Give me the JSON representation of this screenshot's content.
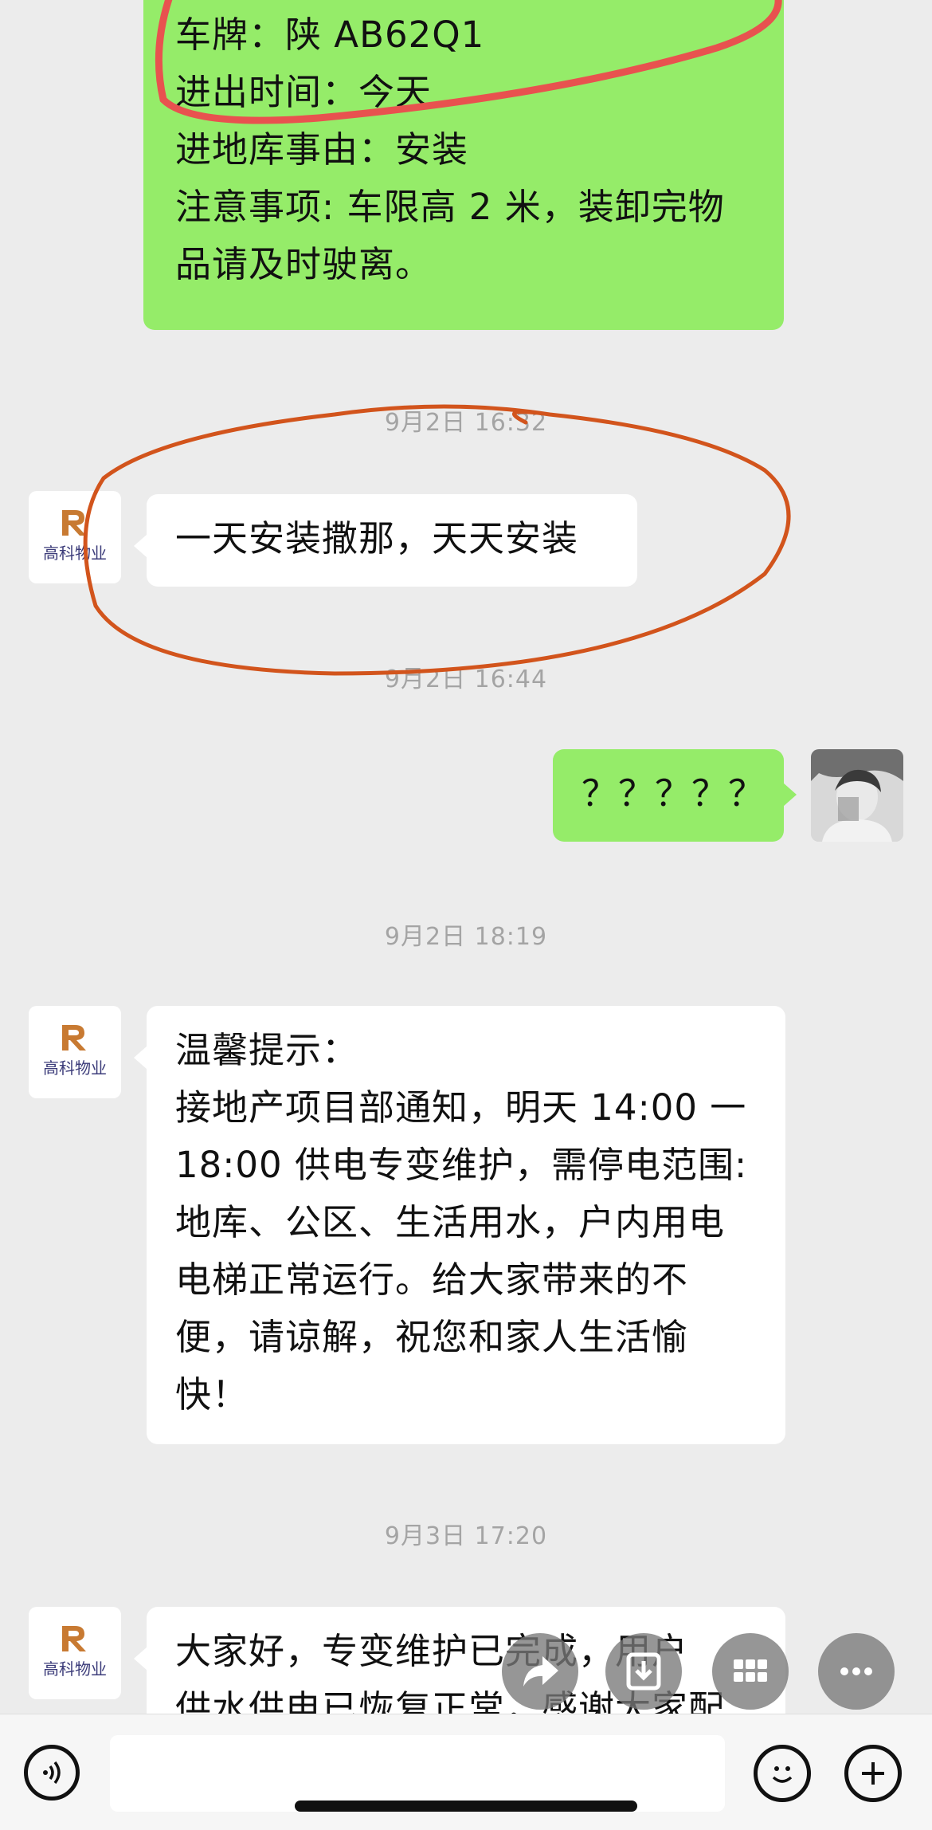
{
  "messages": [
    {
      "sender": "me",
      "lines": [
        "车牌：陕 AB62Q1",
        "进出时间：今天",
        "进地库事由：安装",
        "注意事项: 车限高 2 米，装卸完物",
        "品请及时驶离。"
      ]
    },
    {
      "time": "9月2日 16:32"
    },
    {
      "sender": "property",
      "avatar_text": "高科物业",
      "lines": [
        "一天安装撒那，天天安装"
      ]
    },
    {
      "time": "9月2日 16:44"
    },
    {
      "sender": "me",
      "lines": [
        "？？？？？"
      ]
    },
    {
      "time": "9月2日 18:19"
    },
    {
      "sender": "property",
      "avatar_text": "高科物业",
      "lines": [
        "温馨提示：",
        "接地产项目部通知，明天 14:00 一",
        "18:00 供电专变维护，需停电范围:",
        "地库、公区、生活用水，户内用电",
        "电梯正常运行。给大家带来的不",
        "便，请谅解，祝您和家人生活愉",
        "快！"
      ]
    },
    {
      "time": "9月3日 17:20"
    },
    {
      "sender": "property",
      "avatar_text": "高科物业",
      "lines": [
        "大家好，专变维护已完成，用户",
        "供水供电已恢复正常，感谢大家配"
      ]
    }
  ],
  "annotation_colors": {
    "top_circle": "#e8524f",
    "middle_circle": "#d2541c"
  },
  "floating_actions": [
    "forward-icon",
    "save-icon",
    "more-apps-icon",
    "more-icon"
  ],
  "input": {
    "placeholder": "",
    "value": ""
  },
  "colors": {
    "my_bubble": "#95ec69",
    "other_bubble": "#ffffff",
    "background": "#ececec"
  }
}
